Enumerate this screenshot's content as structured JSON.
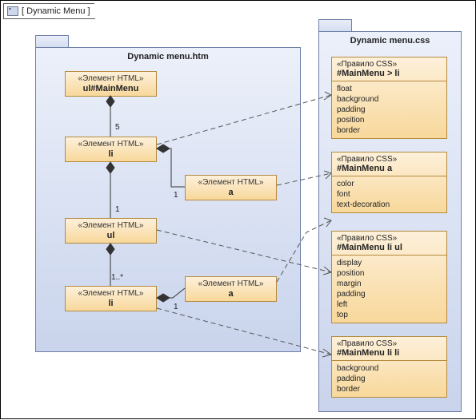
{
  "frame_title": "Dynamic Menu",
  "htm_package_title": "Dynamic menu.htm",
  "css_package_title": "Dynamic menu.css",
  "stereo_html": "«Элемент HTML»",
  "stereo_css": "«Правило CSS»",
  "htm": {
    "ulMain": "ul#MainMenu",
    "li1": "li",
    "a1": "a",
    "ulSub": "ul",
    "li2": "li",
    "a2": "a"
  },
  "css": {
    "r1_name": "#MainMenu > li",
    "r1_props": [
      "float",
      "background",
      "padding",
      "position",
      "border"
    ],
    "r2_name": "#MainMenu a",
    "r2_props": [
      "color",
      "font",
      "text-decoration"
    ],
    "r3_name": "#MainMenu li ul",
    "r3_props": [
      "display",
      "position",
      "margin",
      "padding",
      "left",
      "top"
    ],
    "r4_name": "#MainMenu li li",
    "r4_props": [
      "background",
      "padding",
      "border"
    ]
  },
  "mult": {
    "m5": "5",
    "m1a": "1",
    "m1b": "1",
    "m1c": "1..*",
    "m1d": "1"
  }
}
